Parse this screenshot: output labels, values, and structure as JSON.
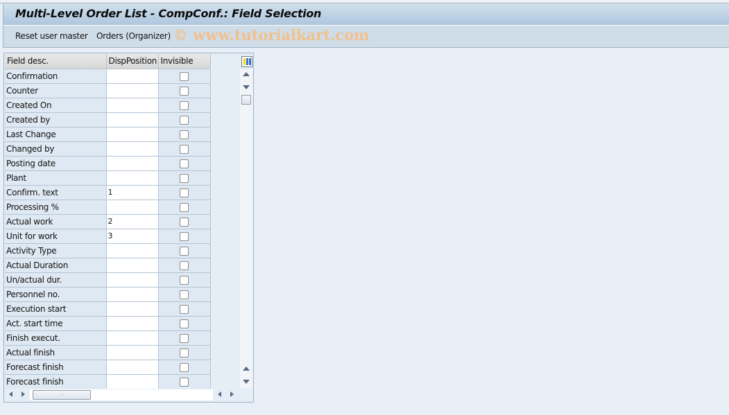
{
  "window": {
    "title": "Multi-Level Order List - CompConf.: Field Selection"
  },
  "toolbar": {
    "buttons": [
      {
        "label": "Reset user master"
      },
      {
        "label": "Orders (Organizer)"
      }
    ],
    "watermark": "© www.tutorialkart.com"
  },
  "table": {
    "columns": [
      "Field desc.",
      "DispPosition",
      "Invisible"
    ],
    "rows": [
      {
        "desc": "Confirmation",
        "pos": "",
        "invisible": false
      },
      {
        "desc": "Counter",
        "pos": "",
        "invisible": false
      },
      {
        "desc": "Created On",
        "pos": "",
        "invisible": false
      },
      {
        "desc": "Created by",
        "pos": "",
        "invisible": false
      },
      {
        "desc": "Last Change",
        "pos": "",
        "invisible": false
      },
      {
        "desc": "Changed by",
        "pos": "",
        "invisible": false
      },
      {
        "desc": "Posting date",
        "pos": "",
        "invisible": false
      },
      {
        "desc": "Plant",
        "pos": "",
        "invisible": false
      },
      {
        "desc": "Confirm. text",
        "pos": "1",
        "invisible": false
      },
      {
        "desc": "Processing %",
        "pos": "",
        "invisible": false
      },
      {
        "desc": "Actual work",
        "pos": "2",
        "invisible": false
      },
      {
        "desc": "Unit for work",
        "pos": "3",
        "invisible": false
      },
      {
        "desc": "Activity Type",
        "pos": "",
        "invisible": false
      },
      {
        "desc": "Actual Duration",
        "pos": "",
        "invisible": false
      },
      {
        "desc": "Un/actual dur.",
        "pos": "",
        "invisible": false
      },
      {
        "desc": "Personnel no.",
        "pos": "",
        "invisible": false
      },
      {
        "desc": "Execution start",
        "pos": "",
        "invisible": false
      },
      {
        "desc": "Act. start time",
        "pos": "",
        "invisible": false
      },
      {
        "desc": "Finish execut.",
        "pos": "",
        "invisible": false
      },
      {
        "desc": "Actual finish",
        "pos": "",
        "invisible": false
      },
      {
        "desc": "Forecast finish",
        "pos": "",
        "invisible": false
      },
      {
        "desc": "Forecast finish",
        "pos": "",
        "invisible": false
      }
    ]
  },
  "icons": {
    "column_settings": "column-config-icon",
    "scroll_up": "arrow-up-icon",
    "scroll_down": "arrow-down-icon",
    "scroll_left": "arrow-left-icon",
    "scroll_right": "arrow-right-icon"
  }
}
